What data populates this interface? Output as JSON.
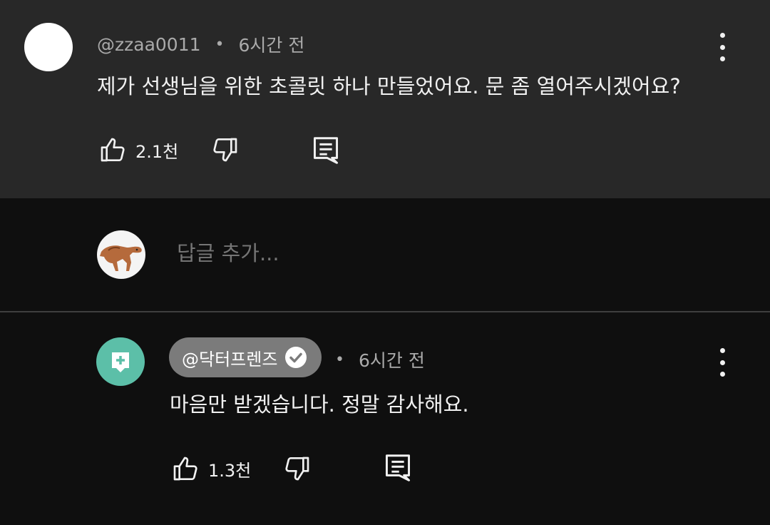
{
  "top_comment": {
    "author": "@zzaa0011",
    "time": "6시간 전",
    "separator": "•",
    "text": "제가 선생님을 위한 초콜릿 하나 만들었어요. 문 좀 열어주시겠어요?",
    "likes": "2.1천"
  },
  "reply_box": {
    "placeholder": "답글 추가..."
  },
  "reply": {
    "author": "@닥터프렌즈",
    "time": "6시간 전",
    "separator": "•",
    "text": "마음만 받겠습니다. 정말 감사해요.",
    "likes": "1.3천"
  },
  "colors": {
    "top_bg": "#282828",
    "page_bg": "#0f0f0f",
    "doctor_avatar": "#5cbfa8",
    "channel_pill": "#7b7b7b",
    "secondary_text": "#aaaaaa"
  },
  "icons": [
    "like-icon",
    "dislike-icon",
    "reply-icon",
    "more-vert-icon",
    "verified-check-icon"
  ]
}
